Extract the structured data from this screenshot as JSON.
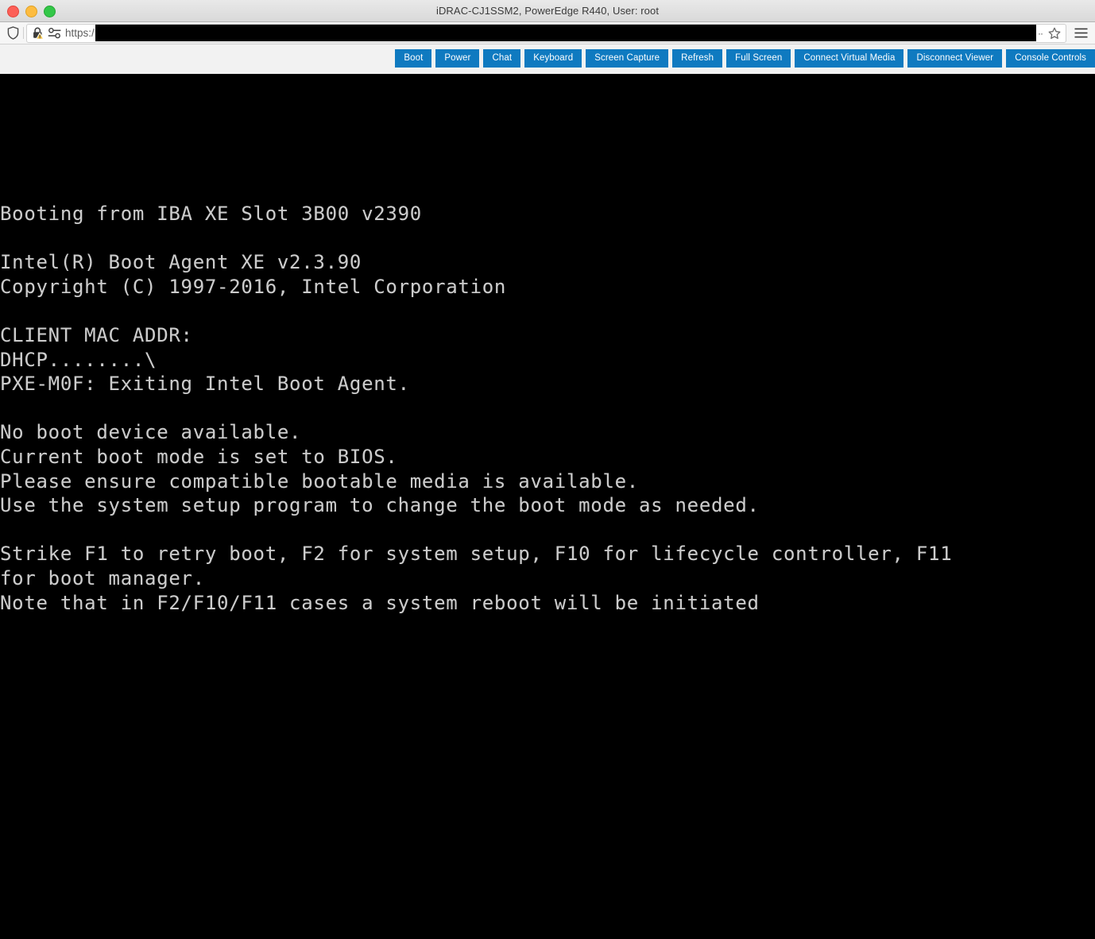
{
  "window": {
    "title": "iDRAC-CJ1SSM2, PowerEdge R440, User: root",
    "controls": {
      "close_label": "close",
      "minimize_label": "minimize",
      "maximize_label": "maximize"
    }
  },
  "urlbar": {
    "scheme_text": "https:/",
    "redacted": true,
    "overflow_dots": "··",
    "icons": {
      "shield": "shield-icon",
      "lock_warning": "lock-warning-icon",
      "permissions": "permissions-icon",
      "bookmark": "star-icon",
      "menu": "hamburger-menu-icon"
    }
  },
  "toolbar": {
    "buttons": [
      {
        "label": "Boot",
        "name": "boot-button"
      },
      {
        "label": "Power",
        "name": "power-button"
      },
      {
        "label": "Chat",
        "name": "chat-button"
      },
      {
        "label": "Keyboard",
        "name": "keyboard-button"
      },
      {
        "label": "Screen Capture",
        "name": "screen-capture-button"
      },
      {
        "label": "Refresh",
        "name": "refresh-button"
      },
      {
        "label": "Full Screen",
        "name": "full-screen-button"
      },
      {
        "label": "Connect Virtual Media",
        "name": "connect-virtual-media-button"
      },
      {
        "label": "Disconnect Viewer",
        "name": "disconnect-viewer-button"
      },
      {
        "label": "Console Controls",
        "name": "console-controls-button"
      }
    ],
    "accent_color": "#0f7ac0",
    "background_color": "#f2f2f2"
  },
  "console": {
    "background_color": "#000000",
    "text_color": "#cccccc",
    "lines": [
      "Booting from IBA XE Slot 3B00 v2390",
      "",
      "Intel(R) Boot Agent XE v2.3.90",
      "Copyright (C) 1997-2016, Intel Corporation",
      "",
      "CLIENT MAC ADDR:",
      "DHCP........\\",
      "PXE-M0F: Exiting Intel Boot Agent.",
      "",
      "No boot device available.",
      "Current boot mode is set to BIOS.",
      "Please ensure compatible bootable media is available.",
      "Use the system setup program to change the boot mode as needed.",
      "",
      "Strike F1 to retry boot, F2 for system setup, F10 for lifecycle controller, F11",
      "for boot manager.",
      "Note that in F2/F10/F11 cases a system reboot will be initiated"
    ]
  }
}
